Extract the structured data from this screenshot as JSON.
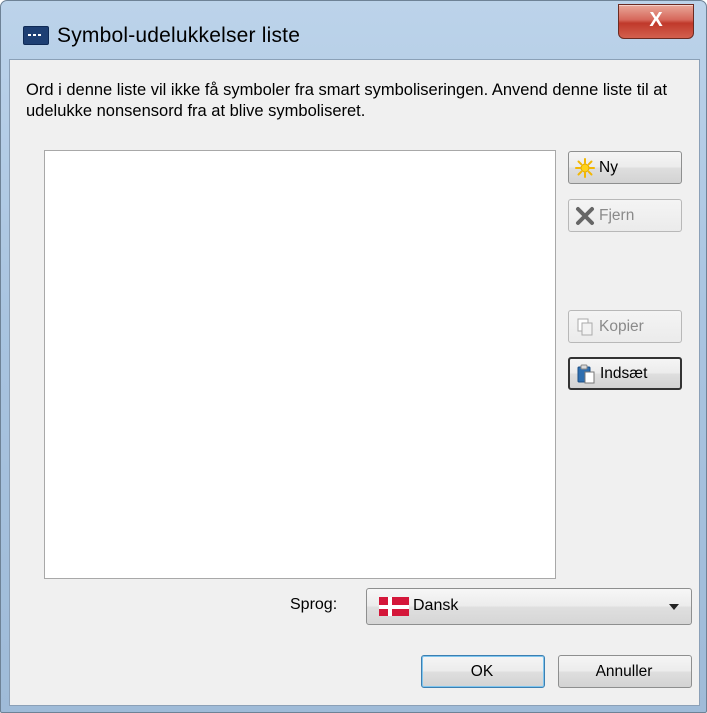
{
  "window": {
    "title": "Symbol-udelukkelser liste",
    "close_label": "X"
  },
  "dialog": {
    "description": "Ord i denne liste vil ikke få symboler fra smart symboliseringen. Anvend denne liste til at udelukke nonsensord fra at blive symboliseret.",
    "list_items": []
  },
  "buttons": {
    "new": {
      "label": "Ny",
      "icon": "sun-icon",
      "enabled": true
    },
    "remove": {
      "label": "Fjern",
      "icon": "x-icon",
      "enabled": false
    },
    "copy": {
      "label": "Kopier",
      "icon": "copy-icon",
      "enabled": false
    },
    "paste": {
      "label": "Indsæt",
      "icon": "paste-icon",
      "enabled": true
    },
    "ok": "OK",
    "cancel": "Annuller"
  },
  "language": {
    "label": "Sprog:",
    "selected": "Dansk",
    "flag": "danish-flag-icon"
  },
  "colors": {
    "title_bar": "#a9c4e0",
    "close_button": "#c0392b",
    "dialog_bg": "#f0f0f0",
    "flag_red": "#d4173a"
  }
}
